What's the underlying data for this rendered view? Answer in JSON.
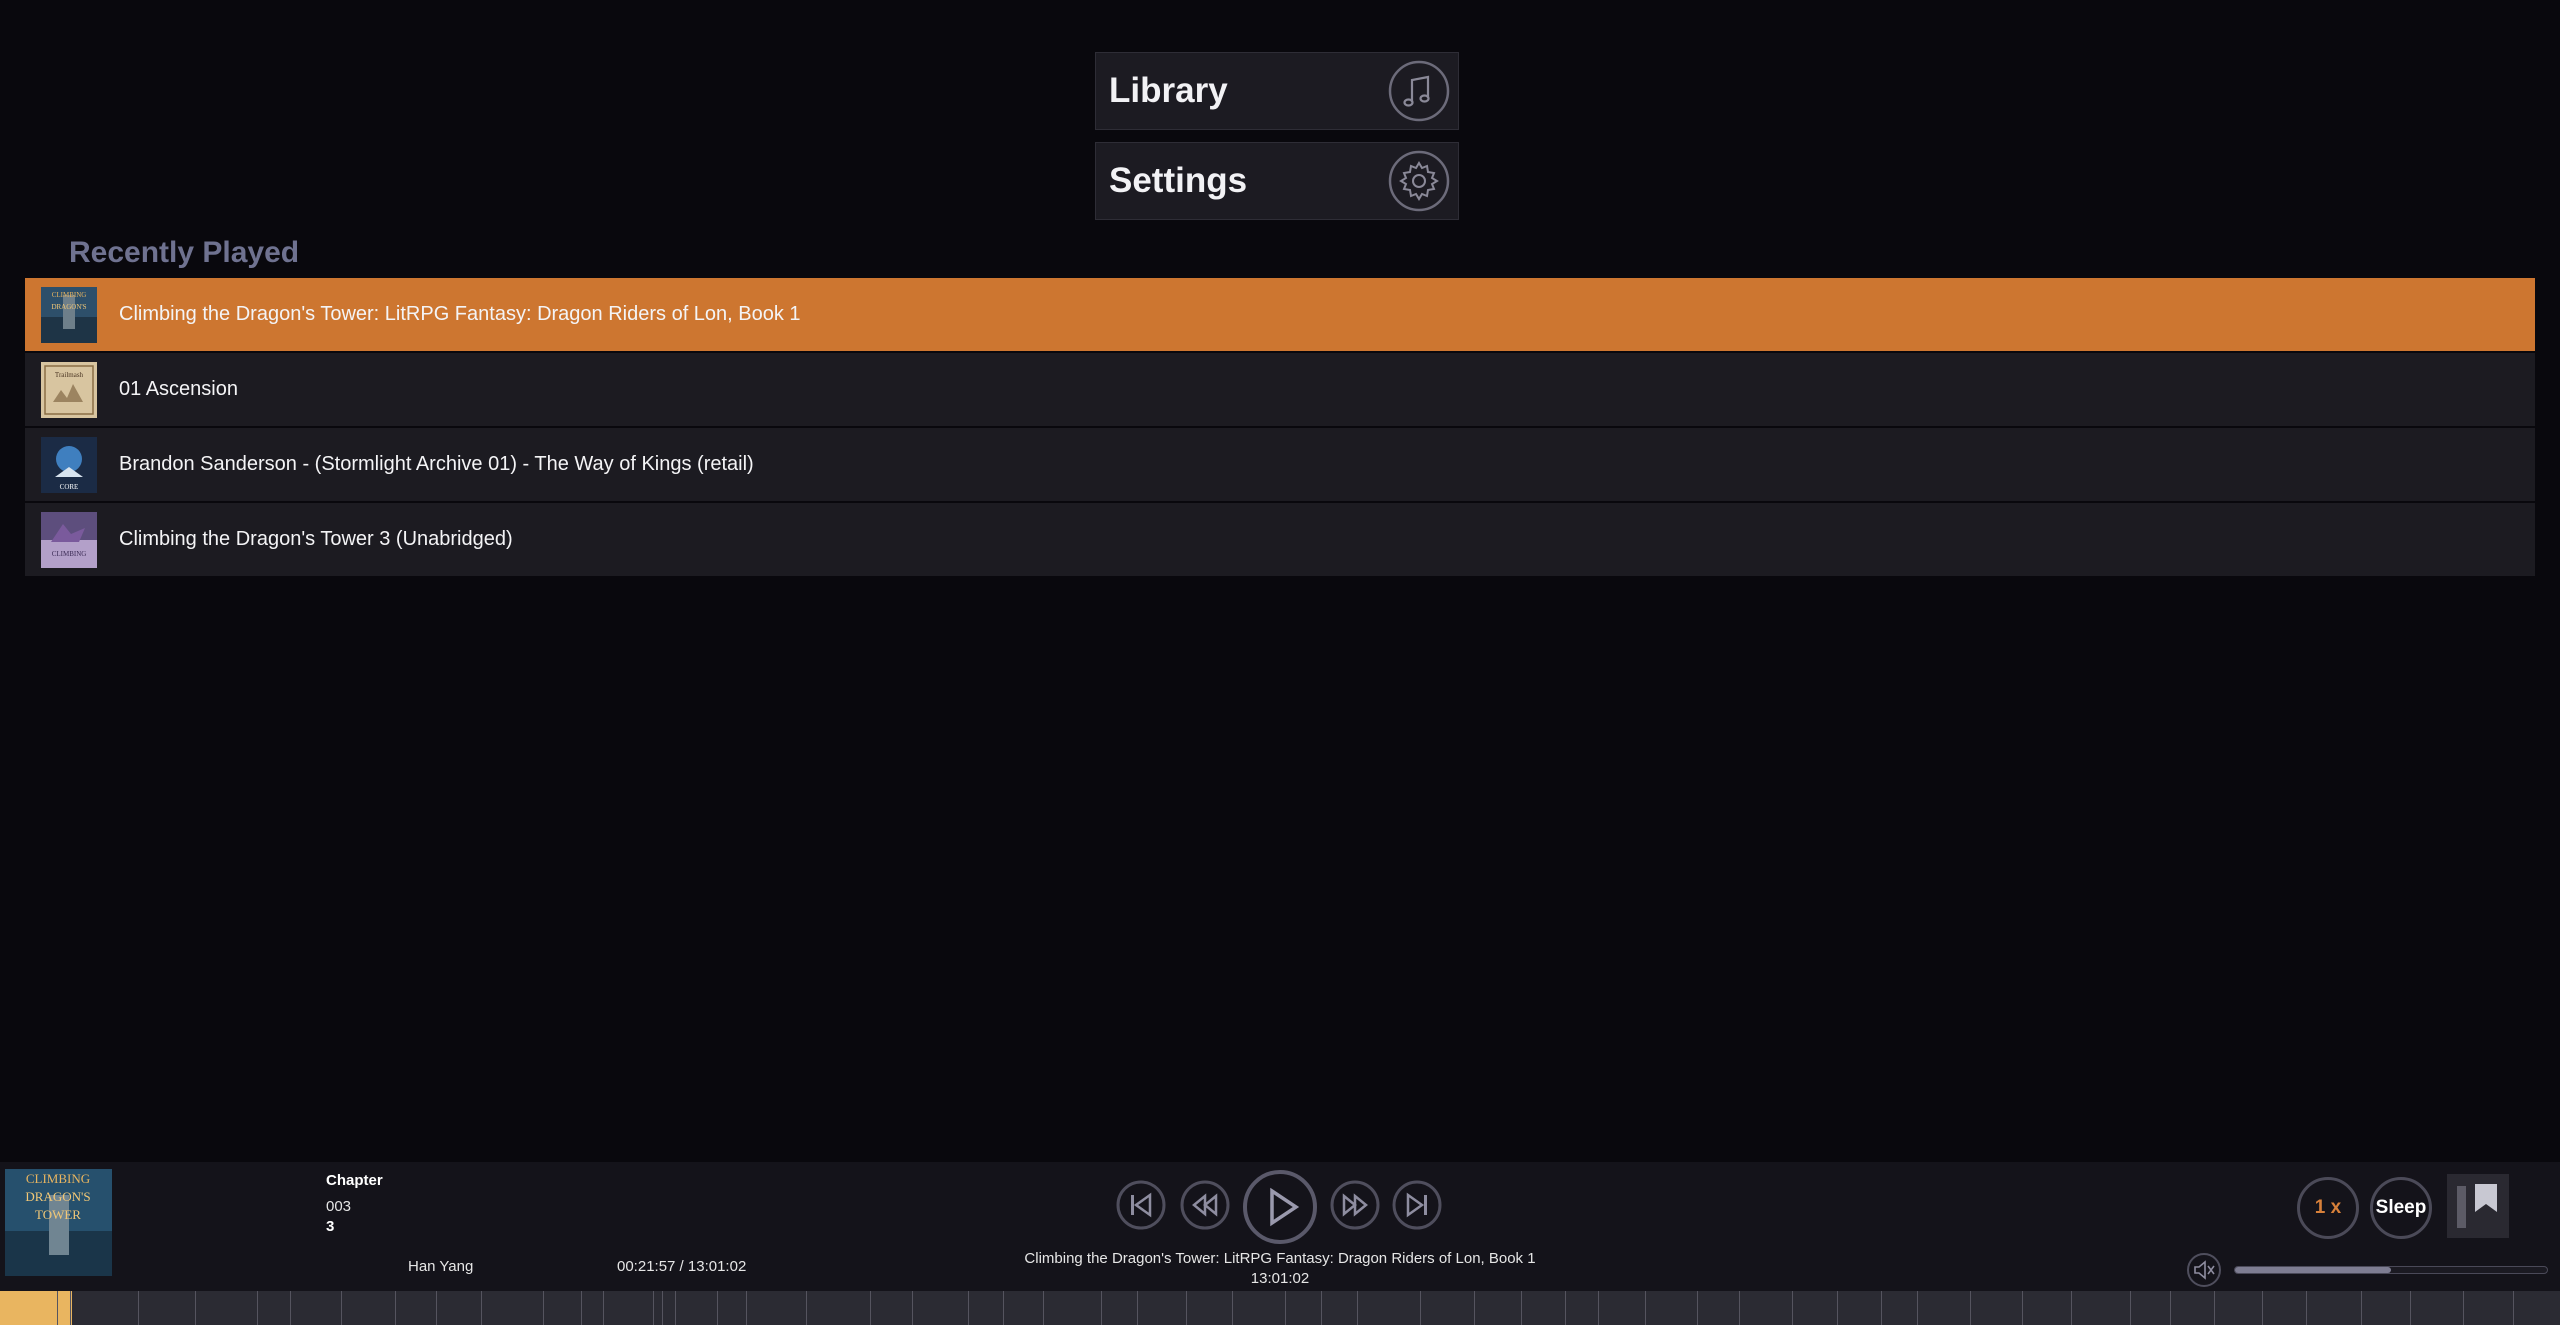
{
  "nav": {
    "library_label": "Library",
    "settings_label": "Settings"
  },
  "recent": {
    "title": "Recently Played",
    "items": [
      {
        "title": "Climbing the Dragon's Tower: LitRPG Fantasy: Dragon Riders of Lon, Book 1",
        "active": true
      },
      {
        "title": "01 Ascension",
        "active": false
      },
      {
        "title": "Brandon Sanderson - (Stormlight Archive 01) - The Way of Kings (retail)",
        "active": false
      },
      {
        "title": "Climbing the Dragon's Tower 3 (Unabridged)",
        "active": false
      }
    ]
  },
  "player": {
    "chapter_label": "Chapter",
    "chapter_number": "003",
    "chapter_title": "3",
    "author": "Han Yang",
    "position": "00:21:57 / 13:01:02",
    "now_playing_title": "Climbing the Dragon's Tower: LitRPG Fantasy: Dragon Riders of Lon, Book 1",
    "duration": "13:01:02",
    "speed_label": "1 x",
    "sleep_label": "Sleep",
    "volume_fraction": 0.5,
    "progress_fraction": 0.028
  },
  "colors": {
    "accent": "#cd7630",
    "background": "#09080d",
    "speed_text": "#d7803a",
    "timeline_played": "#e9b560"
  }
}
